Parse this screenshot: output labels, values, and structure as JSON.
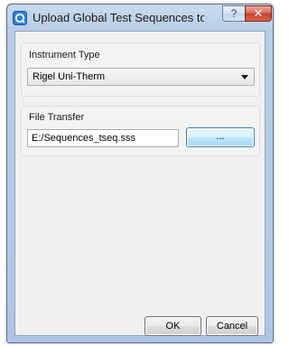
{
  "window": {
    "title": "Upload Global Test Sequences to...",
    "help_glyph": "?",
    "close_glyph": "✕"
  },
  "instrument_group": {
    "label": "Instrument Type",
    "selected_value": "Rigel Uni-Therm"
  },
  "file_group": {
    "label": "File Transfer",
    "path_value": "E:/Sequences_tseq.sss",
    "browse_label": "..."
  },
  "buttons": {
    "ok_label": "OK",
    "cancel_label": "Cancel"
  },
  "icons": {
    "app_icon": "app-icon",
    "help_icon": "help-icon",
    "close_icon": "close-icon",
    "dropdown_icon": "chevron-down-icon"
  }
}
